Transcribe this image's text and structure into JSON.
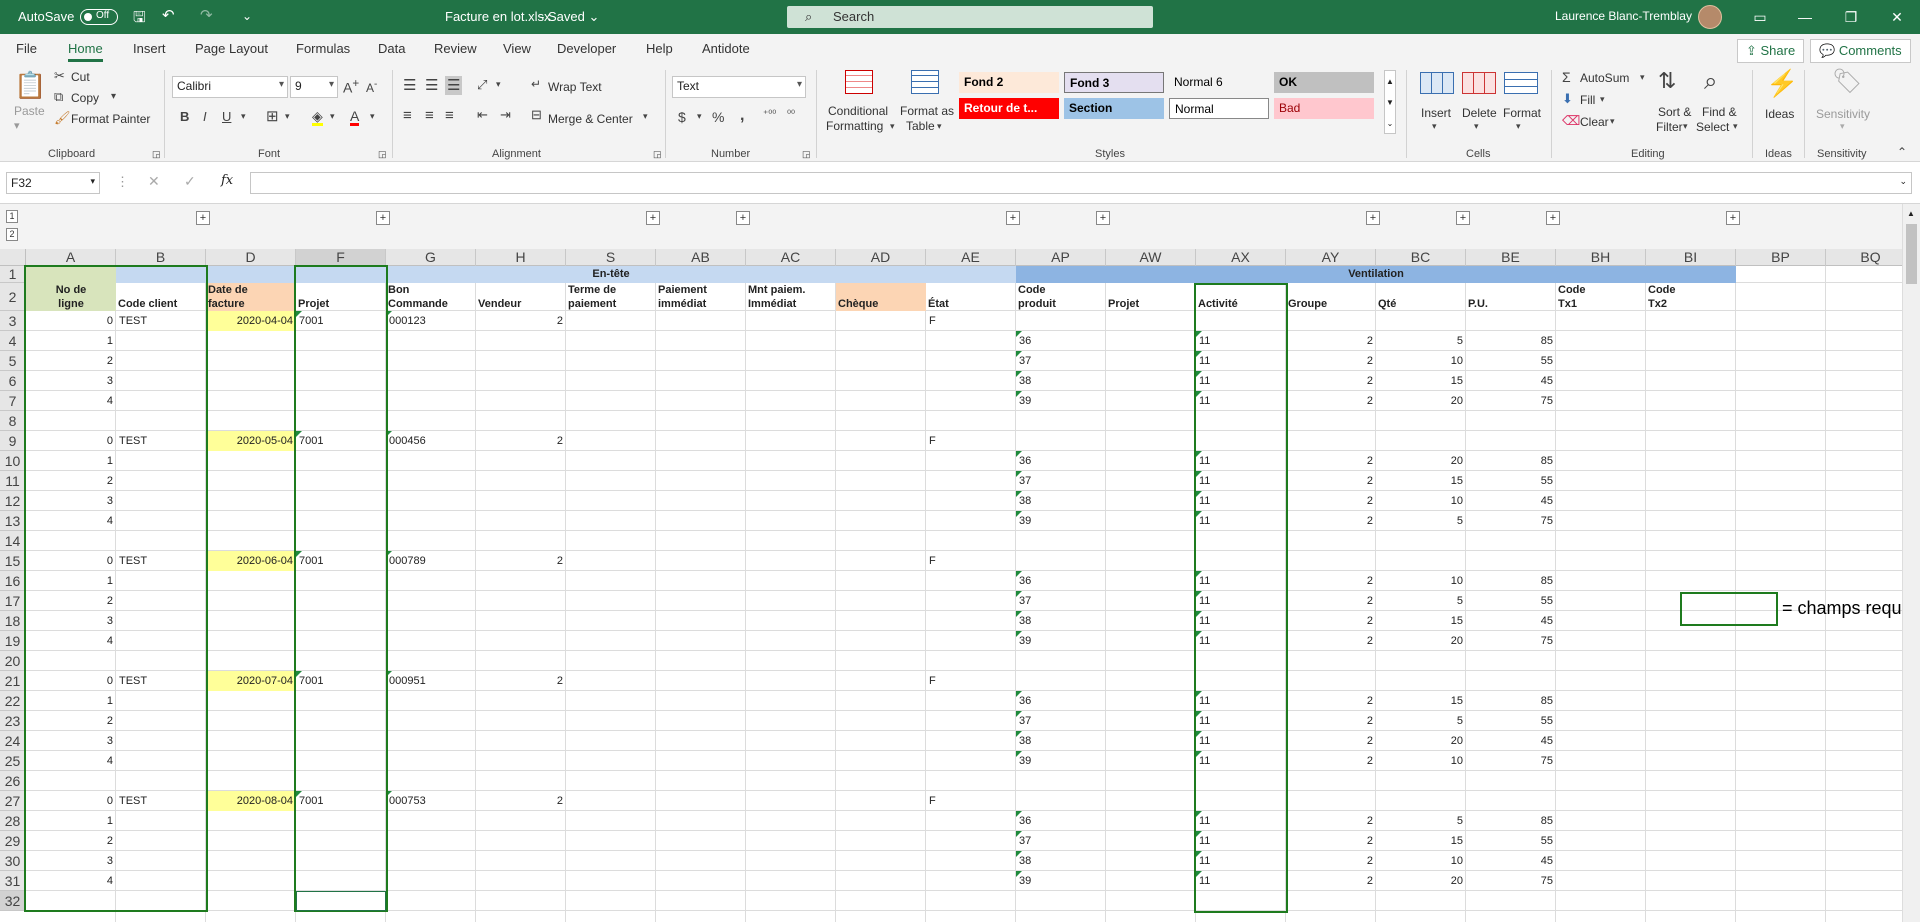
{
  "titlebar": {
    "autosave_label": "AutoSave",
    "autosave_state": "Off",
    "filename": "Facture en lot.xlsx",
    "saved_state": "Saved",
    "search_placeholder": "Search",
    "user_name": "Laurence Blanc-Tremblay"
  },
  "tabs": [
    "File",
    "Home",
    "Insert",
    "Page Layout",
    "Formulas",
    "Data",
    "Review",
    "View",
    "Developer",
    "Help",
    "Antidote"
  ],
  "active_tab": "Home",
  "share_label": "Share",
  "comments_label": "Comments",
  "ribbon": {
    "clipboard": {
      "paste": "Paste",
      "cut": "Cut",
      "copy": "Copy",
      "format_painter": "Format Painter",
      "group": "Clipboard"
    },
    "font": {
      "name": "Calibri",
      "size": "9",
      "group": "Font"
    },
    "alignment": {
      "wrap": "Wrap Text",
      "merge": "Merge & Center",
      "group": "Alignment"
    },
    "number": {
      "format": "Text",
      "group": "Number"
    },
    "styles": {
      "cond1": "Conditional",
      "cond2": "Formatting",
      "fat1": "Format as",
      "fat2": "Table",
      "group": "Styles",
      "cells": [
        {
          "label": "Fond 2",
          "bg": "#fde9d9",
          "fg": "#000000"
        },
        {
          "label": "Fond 3",
          "bg": "#e4dff0",
          "fg": "#000000"
        },
        {
          "label": "Normal 6",
          "bg": "#f3f3f3",
          "fg": "#000000"
        },
        {
          "label": "OK",
          "bg": "#c0c0c0",
          "fg": "#000000"
        },
        {
          "label": "Retour de t...",
          "bg": "#ff0000",
          "fg": "#ffffff"
        },
        {
          "label": "Section",
          "bg": "#9dc3e6",
          "fg": "#000000"
        },
        {
          "label": "Normal",
          "bg": "#ffffff",
          "fg": "#000000"
        },
        {
          "label": "Bad",
          "bg": "#ffc7ce",
          "fg": "#9c0006"
        }
      ]
    },
    "cells": {
      "insert": "Insert",
      "delete": "Delete",
      "format": "Format",
      "group": "Cells"
    },
    "editing": {
      "autosum": "AutoSum",
      "fill": "Fill",
      "clear": "Clear",
      "sort1": "Sort &",
      "sort2": "Filter",
      "find1": "Find &",
      "find2": "Select",
      "group": "Editing"
    },
    "ideas": {
      "label": "Ideas",
      "group": "Ideas"
    },
    "sensitivity": {
      "label": "Sensitivity",
      "group": "Sensitivity"
    }
  },
  "formula_bar": {
    "name_box": "F32",
    "fx": "fx",
    "value": ""
  },
  "outline_levels": [
    "1",
    "2"
  ],
  "columns": [
    "A",
    "B",
    "D",
    "F",
    "G",
    "H",
    "S",
    "AB",
    "AC",
    "AD",
    "AE",
    "AP",
    "AW",
    "AX",
    "AY",
    "BC",
    "BE",
    "BH",
    "BI",
    "BP",
    "BQ"
  ],
  "group_headers": {
    "entete": "En-tête",
    "ventilation": "Ventilation"
  },
  "headers": {
    "A": [
      "No de",
      "ligne"
    ],
    "B": [
      "",
      "Code client"
    ],
    "D": [
      "Date de",
      "facture"
    ],
    "F": [
      "",
      "Projet"
    ],
    "G": [
      "Bon",
      "Commande"
    ],
    "H": [
      "",
      "Vendeur"
    ],
    "S": [
      "Terme de",
      "paiement"
    ],
    "AB": [
      "Paiement",
      "immédiat"
    ],
    "AC": [
      "Mnt paiem.",
      "Immédiat"
    ],
    "AD": [
      "",
      "Chèque"
    ],
    "AE": [
      "",
      "État"
    ],
    "AP": [
      "Code",
      "produit"
    ],
    "AW": [
      "",
      "Projet"
    ],
    "AX": [
      "",
      "Activité"
    ],
    "AY": [
      "",
      "Groupe"
    ],
    "BC": [
      "",
      "Qté"
    ],
    "BE": [
      "",
      "P.U."
    ],
    "BH": [
      "Code",
      "Tx1"
    ],
    "BI": [
      "Code",
      "Tx2"
    ]
  },
  "row_numbers": [
    "1",
    "2",
    "3",
    "4",
    "5",
    "6",
    "7",
    "8",
    "9",
    "10",
    "11",
    "12",
    "13",
    "14",
    "15",
    "16",
    "17",
    "18",
    "19",
    "20",
    "21",
    "22",
    "23",
    "24",
    "25",
    "26",
    "27",
    "28",
    "29",
    "30",
    "31",
    "32"
  ],
  "invoices": [
    {
      "client": "TEST",
      "date": "2020-04-04",
      "projet": "7001",
      "bon": "000123",
      "vendeur": "2",
      "etat": "F",
      "lines": [
        {
          "code": "36",
          "act": "11",
          "grp": "2",
          "qte": "5",
          "pu": "85"
        },
        {
          "code": "37",
          "act": "11",
          "grp": "2",
          "qte": "10",
          "pu": "55"
        },
        {
          "code": "38",
          "act": "11",
          "grp": "2",
          "qte": "15",
          "pu": "45"
        },
        {
          "code": "39",
          "act": "11",
          "grp": "2",
          "qte": "20",
          "pu": "75"
        }
      ]
    },
    {
      "client": "TEST",
      "date": "2020-05-04",
      "projet": "7001",
      "bon": "000456",
      "vendeur": "2",
      "etat": "F",
      "lines": [
        {
          "code": "36",
          "act": "11",
          "grp": "2",
          "qte": "20",
          "pu": "85"
        },
        {
          "code": "37",
          "act": "11",
          "grp": "2",
          "qte": "15",
          "pu": "55"
        },
        {
          "code": "38",
          "act": "11",
          "grp": "2",
          "qte": "10",
          "pu": "45"
        },
        {
          "code": "39",
          "act": "11",
          "grp": "2",
          "qte": "5",
          "pu": "75"
        }
      ]
    },
    {
      "client": "TEST",
      "date": "2020-06-04",
      "projet": "7001",
      "bon": "000789",
      "vendeur": "2",
      "etat": "F",
      "lines": [
        {
          "code": "36",
          "act": "11",
          "grp": "2",
          "qte": "10",
          "pu": "85"
        },
        {
          "code": "37",
          "act": "11",
          "grp": "2",
          "qte": "5",
          "pu": "55"
        },
        {
          "code": "38",
          "act": "11",
          "grp": "2",
          "qte": "15",
          "pu": "45"
        },
        {
          "code": "39",
          "act": "11",
          "grp": "2",
          "qte": "20",
          "pu": "75"
        }
      ]
    },
    {
      "client": "TEST",
      "date": "2020-07-04",
      "projet": "7001",
      "bon": "000951",
      "vendeur": "2",
      "etat": "F",
      "lines": [
        {
          "code": "36",
          "act": "11",
          "grp": "2",
          "qte": "15",
          "pu": "85"
        },
        {
          "code": "37",
          "act": "11",
          "grp": "2",
          "qte": "5",
          "pu": "55"
        },
        {
          "code": "38",
          "act": "11",
          "grp": "2",
          "qte": "20",
          "pu": "45"
        },
        {
          "code": "39",
          "act": "11",
          "grp": "2",
          "qte": "10",
          "pu": "75"
        }
      ]
    },
    {
      "client": "TEST",
      "date": "2020-08-04",
      "projet": "7001",
      "bon": "000753",
      "vendeur": "2",
      "etat": "F",
      "lines": [
        {
          "code": "36",
          "act": "11",
          "grp": "2",
          "qte": "5",
          "pu": "85"
        },
        {
          "code": "37",
          "act": "11",
          "grp": "2",
          "qte": "15",
          "pu": "55"
        },
        {
          "code": "38",
          "act": "11",
          "grp": "2",
          "qte": "10",
          "pu": "45"
        },
        {
          "code": "39",
          "act": "11",
          "grp": "2",
          "qte": "20",
          "pu": "75"
        }
      ]
    }
  ],
  "line_numbers": [
    "0",
    "1",
    "2",
    "3",
    "4"
  ],
  "legend_text": "= champs requis",
  "colors": {
    "excel_green": "#217346",
    "required_box": "#1e7b1e",
    "entete_header": "#c5d9f1",
    "ventilation_header": "#8db4e2",
    "date_fill": "#ffff99",
    "date_header": "#fcd5b4",
    "no_ligne_fill": "#d8e4bc"
  }
}
